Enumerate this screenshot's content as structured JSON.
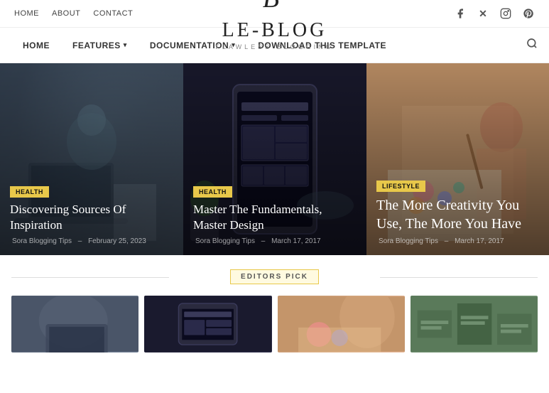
{
  "topbar": {
    "nav": [
      {
        "label": "HOME",
        "key": "home"
      },
      {
        "label": "ABOUT",
        "key": "about"
      },
      {
        "label": "CONTACT",
        "key": "contact"
      }
    ],
    "social": [
      {
        "name": "facebook",
        "icon": "f"
      },
      {
        "name": "twitter-x",
        "icon": "𝕏"
      },
      {
        "name": "instagram",
        "icon": "◻"
      },
      {
        "name": "pinterest",
        "icon": "𝑃"
      }
    ]
  },
  "logo": {
    "text": "LE-BLOG",
    "subtitle": "FLAWLESS BLOGGING"
  },
  "mainnav": {
    "items": [
      {
        "label": "HOME",
        "has_dropdown": false
      },
      {
        "label": "FEATURES",
        "has_dropdown": true
      },
      {
        "label": "DOCUMENTATION",
        "has_dropdown": true
      },
      {
        "label": "DOWNLOAD THIS TEMPLATE",
        "has_dropdown": false
      }
    ]
  },
  "hero": {
    "cards": [
      {
        "tag": "HEALTH",
        "tag_color": "#e8c84a",
        "title": "Discovering Sources Of Inspiration",
        "author": "Sora Blogging Tips",
        "separator": "–",
        "date": "February 25, 2023"
      },
      {
        "tag": "HEALTH",
        "tag_color": "#e8c84a",
        "title": "Master The Fundamentals, Master Design",
        "author": "Sora Blogging Tips",
        "separator": "–",
        "date": "March 17, 2017"
      },
      {
        "tag": "LIFESTYLE",
        "tag_color": "#e8c84a",
        "title": "The More Creativity You Use, The More You Have",
        "author": "Sora Blogging Tips",
        "separator": "–",
        "date": "March 17, 2017"
      }
    ]
  },
  "editors_pick": {
    "label": "EDITORS PICK",
    "cards": [
      {
        "key": "ep1"
      },
      {
        "key": "ep2"
      },
      {
        "key": "ep3"
      },
      {
        "key": "ep4"
      }
    ]
  }
}
